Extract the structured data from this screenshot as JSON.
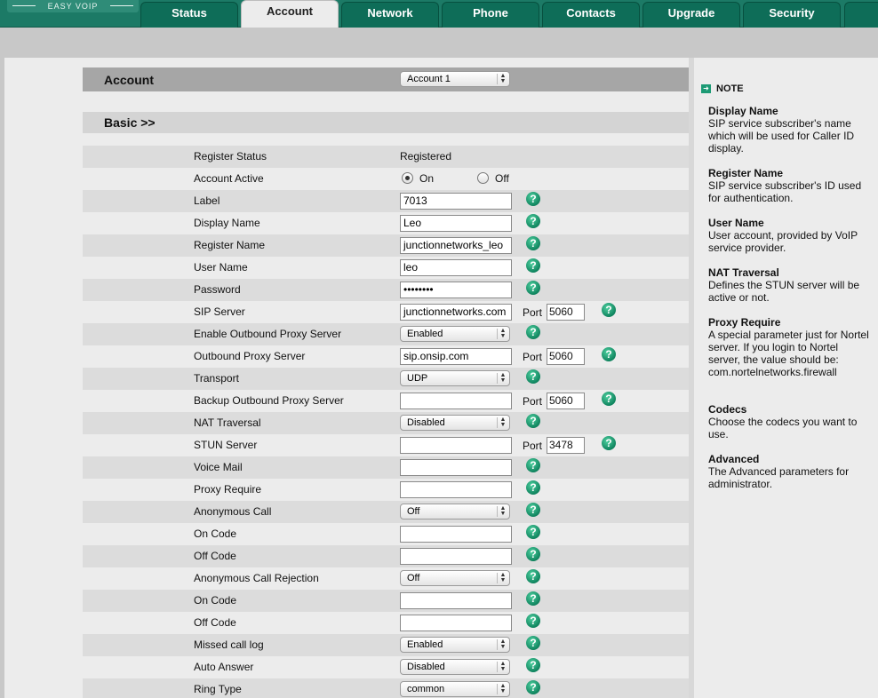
{
  "logo": "EASY VOIP",
  "tabs": [
    {
      "label": "Status"
    },
    {
      "label": "Account"
    },
    {
      "label": "Network"
    },
    {
      "label": "Phone"
    },
    {
      "label": "Contacts"
    },
    {
      "label": "Upgrade"
    },
    {
      "label": "Security"
    }
  ],
  "account_header": {
    "title": "Account",
    "select_value": "Account 1"
  },
  "basic_header": "Basic >>",
  "rows": {
    "register_status": {
      "label": "Register Status",
      "value": "Registered"
    },
    "account_active": {
      "label": "Account Active",
      "on": "On",
      "off": "Off",
      "selected": "On"
    },
    "label": {
      "label": "Label",
      "value": "7013"
    },
    "display_name": {
      "label": "Display Name",
      "value": "Leo"
    },
    "register_name": {
      "label": "Register Name",
      "value": "junctionnetworks_leo"
    },
    "user_name": {
      "label": "User Name",
      "value": "leo"
    },
    "password": {
      "label": "Password",
      "value": "••••••••"
    },
    "sip_server": {
      "label": "SIP Server",
      "value": "junctionnetworks.com",
      "port_label": "Port",
      "port": "5060"
    },
    "enable_outbound_proxy": {
      "label": "Enable Outbound Proxy Server",
      "value": "Enabled"
    },
    "outbound_proxy_server": {
      "label": "Outbound Proxy Server",
      "value": "sip.onsip.com",
      "port_label": "Port",
      "port": "5060"
    },
    "transport": {
      "label": "Transport",
      "value": "UDP"
    },
    "backup_outbound_proxy": {
      "label": "Backup Outbound Proxy Server",
      "value": "",
      "port_label": "Port",
      "port": "5060"
    },
    "nat_traversal": {
      "label": "NAT Traversal",
      "value": "Disabled"
    },
    "stun_server": {
      "label": "STUN Server",
      "value": "",
      "port_label": "Port",
      "port": "3478"
    },
    "voice_mail": {
      "label": "Voice Mail",
      "value": ""
    },
    "proxy_require": {
      "label": "Proxy Require",
      "value": ""
    },
    "anonymous_call": {
      "label": "Anonymous Call",
      "value": "Off"
    },
    "on_code_1": {
      "label": "On Code",
      "value": ""
    },
    "off_code_1": {
      "label": "Off Code",
      "value": ""
    },
    "anonymous_call_rejection": {
      "label": "Anonymous Call Rejection",
      "value": "Off"
    },
    "on_code_2": {
      "label": "On Code",
      "value": ""
    },
    "off_code_2": {
      "label": "Off Code",
      "value": ""
    },
    "missed_call_log": {
      "label": "Missed call log",
      "value": "Enabled"
    },
    "auto_answer": {
      "label": "Auto Answer",
      "value": "Disabled"
    },
    "ring_type": {
      "label": "Ring Type",
      "value": "common"
    }
  },
  "help_glyph": "?",
  "note": {
    "title": "NOTE",
    "items": [
      {
        "title": "Display Name",
        "text": "SIP service subscriber's name which will be used for Caller ID display."
      },
      {
        "title": "Register Name",
        "text": "SIP service subscriber's ID used for authentication."
      },
      {
        "title": "User Name",
        "text": "User account, provided by VoIP service provider."
      },
      {
        "title": "NAT Traversal",
        "text": "Defines the STUN server will be active or not."
      },
      {
        "title": "Proxy Require",
        "text": "A special parameter just for Nortel server. If you login to Nortel server, the value should be: com.nortelnetworks.firewall"
      },
      {
        "title": "Codecs",
        "text": "Choose the codecs you want to use."
      },
      {
        "title": "Advanced",
        "text": "The Advanced parameters for administrator."
      }
    ]
  },
  "colors": {
    "nav": "#0e6d58",
    "help": "#0b7f5a",
    "header": "#a6a6a6"
  }
}
